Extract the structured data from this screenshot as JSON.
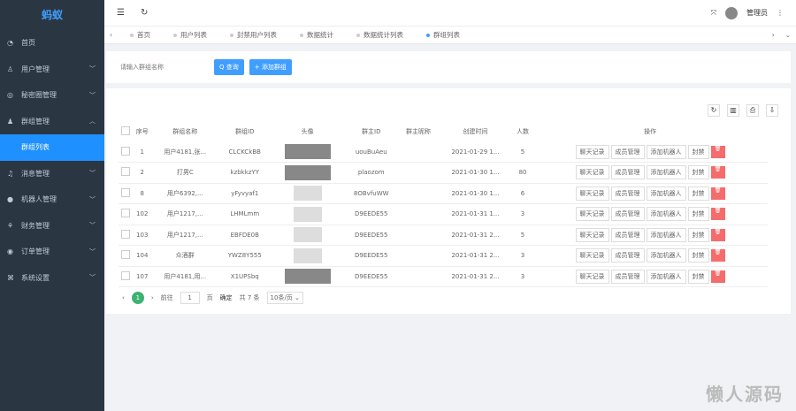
{
  "sidebar": {
    "logo": "蚂蚁",
    "items": [
      {
        "label": "首页",
        "icon": "◔"
      },
      {
        "label": "用户管理",
        "icon": "♙"
      },
      {
        "label": "秘密圈管理",
        "icon": "◎"
      },
      {
        "label": "群组管理",
        "icon": "♟"
      },
      {
        "label": "群组列表",
        "icon": ""
      },
      {
        "label": "消息管理",
        "icon": "♫"
      },
      {
        "label": "机器人管理",
        "icon": "●"
      },
      {
        "label": "财务管理",
        "icon": "⚘"
      },
      {
        "label": "订单管理",
        "icon": "◉"
      },
      {
        "label": "系统设置",
        "icon": "⌘"
      }
    ]
  },
  "header": {
    "user": "管理员"
  },
  "tabs": [
    "首页",
    "用户列表",
    "封禁用户列表",
    "数据统计",
    "数据统计列表",
    "群组列表"
  ],
  "search": {
    "placeholder": "请输入群组名称",
    "search_btn": "Q 查询",
    "add_btn": "+ 添加群组"
  },
  "table": {
    "headers": [
      "序号",
      "群组名称",
      "群组ID",
      "头像",
      "群主ID",
      "群主昵称",
      "创建时间",
      "人数",
      "操作"
    ],
    "rows": [
      [
        "1",
        "用户4181,张...",
        "CLCKCkBB",
        "",
        "uouBuAeu",
        "",
        "2021-01-29 1...",
        "5"
      ],
      [
        "2",
        "打男C",
        "kzbkkzYY",
        "",
        "plaozom",
        "",
        "2021-01-30 1...",
        "80"
      ],
      [
        "8",
        "用户6392,...",
        "yFyvyaf1",
        "",
        "8OBvfuWW",
        "",
        "2021-01-30 1...",
        "6"
      ],
      [
        "102",
        "用户1217,...",
        "LHMLmm",
        "",
        "D9EEDE55",
        "",
        "2021-01-31 1...",
        "3"
      ],
      [
        "103",
        "用户1217,...",
        "EBFDE0B",
        "",
        "D9EEDE55",
        "",
        "2021-01-31 2...",
        "5"
      ],
      [
        "104",
        "众酒群",
        "YWZ8Y555",
        "",
        "D9EEDE55",
        "",
        "2021-01-31 2...",
        "3"
      ],
      [
        "107",
        "用户4181,用...",
        "X1UPSbq",
        "",
        "D9EEDE55",
        "",
        "2021-01-31 2...",
        "3"
      ]
    ],
    "actions": [
      "聊天记录",
      "成员管理",
      "添加机器人",
      "封禁"
    ]
  },
  "pager": {
    "page": "1",
    "goto": "前往",
    "page_unit": "页",
    "confirm": "确定",
    "total": "共 7 条",
    "size": "10条/页 ⌄"
  },
  "watermark": "懒人源码"
}
